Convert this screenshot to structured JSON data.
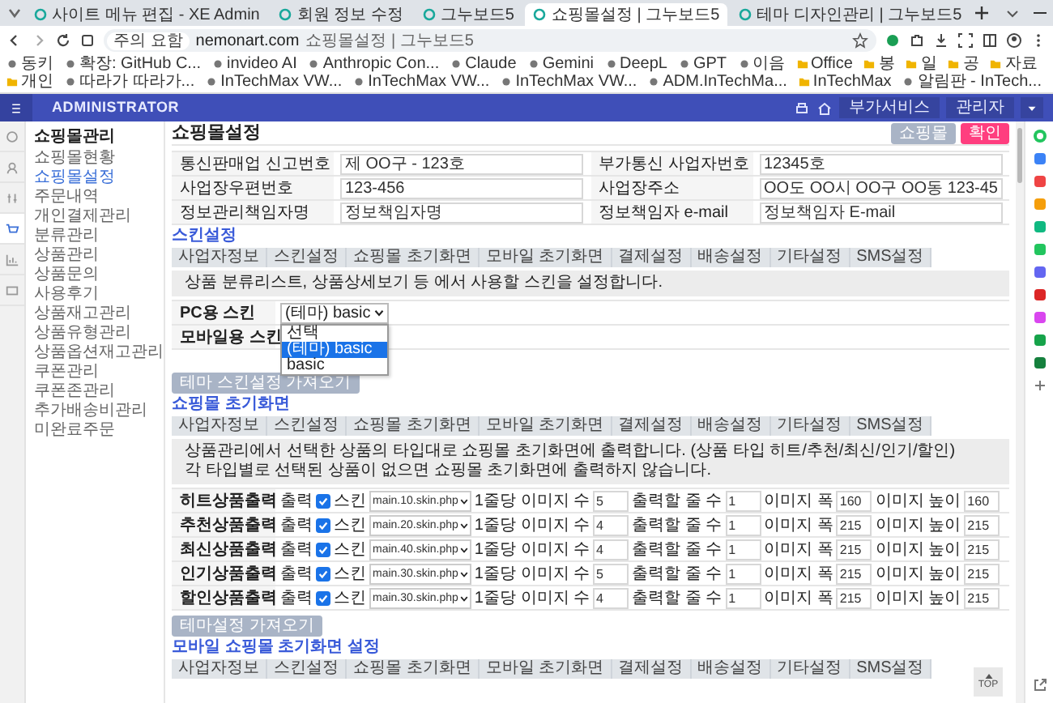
{
  "browser": {
    "tabs": [
      {
        "title": "사이트 메뉴 편집 - XE Admin",
        "selected": false
      },
      {
        "title": "회원 정보 수정",
        "selected": false
      },
      {
        "title": "그누보드5",
        "selected": false
      },
      {
        "title": "쇼핑몰설정 | 그누보드5",
        "selected": true
      },
      {
        "title": "테마 디자인관리 | 그누보드5",
        "selected": false
      }
    ],
    "address": {
      "security": "주의 요함",
      "host": "nemonart.com",
      "page_title": "쇼핑몰설정 | 그누보드5"
    },
    "bookmarks": [
      {
        "label": "동키",
        "kind": "site"
      },
      {
        "label": "확장: GitHub C...",
        "kind": "site"
      },
      {
        "label": "invideo AI",
        "kind": "site"
      },
      {
        "label": "Anthropic Con...",
        "kind": "site"
      },
      {
        "label": "Claude",
        "kind": "site"
      },
      {
        "label": "Gemini",
        "kind": "site"
      },
      {
        "label": "DeepL",
        "kind": "site"
      },
      {
        "label": "GPT",
        "kind": "site"
      },
      {
        "label": "이음",
        "kind": "site"
      },
      {
        "label": "Office",
        "kind": "folder"
      },
      {
        "label": "봉",
        "kind": "folder"
      },
      {
        "label": "일",
        "kind": "folder"
      },
      {
        "label": "공",
        "kind": "folder"
      },
      {
        "label": "자료",
        "kind": "folder"
      },
      {
        "label": "개인",
        "kind": "folder"
      },
      {
        "label": "따라가 따라가...",
        "kind": "site"
      },
      {
        "label": "InTechMax VW...",
        "kind": "site"
      },
      {
        "label": "InTechMax VW...",
        "kind": "site"
      },
      {
        "label": "InTechMax VW...",
        "kind": "site"
      },
      {
        "label": "ADM.InTechMa...",
        "kind": "site"
      },
      {
        "label": "InTechMax",
        "kind": "folder"
      },
      {
        "label": "알림판 - InTech...",
        "kind": "site"
      }
    ]
  },
  "header": {
    "brand": "ADMINISTRATOR",
    "buttons": [
      "부가서비스",
      "관리자"
    ]
  },
  "sidebar": {
    "title": "쇼핑몰관리",
    "items": [
      {
        "label": "쇼핑몰현황",
        "selected": false
      },
      {
        "label": "쇼핑몰설정",
        "selected": true
      },
      {
        "label": "주문내역",
        "selected": false
      },
      {
        "label": "개인결제관리",
        "selected": false
      },
      {
        "label": "분류관리",
        "selected": false
      },
      {
        "label": "상품관리",
        "selected": false
      },
      {
        "label": "상품문의",
        "selected": false
      },
      {
        "label": "사용후기",
        "selected": false
      },
      {
        "label": "상품재고관리",
        "selected": false
      },
      {
        "label": "상품유형관리",
        "selected": false
      },
      {
        "label": "상품옵션재고관리",
        "selected": false
      },
      {
        "label": "쿠폰관리",
        "selected": false
      },
      {
        "label": "쿠폰존관리",
        "selected": false
      },
      {
        "label": "추가배송비관리",
        "selected": false
      },
      {
        "label": "미완료주문",
        "selected": false
      }
    ]
  },
  "page": {
    "title": "쇼핑몰설정",
    "buttons": [
      {
        "label": "쇼핑몰",
        "kind": "secondary"
      },
      {
        "label": "확인",
        "kind": "primary"
      }
    ],
    "info_rows": [
      [
        {
          "label": "통신판매업 신고번호",
          "value": "제 OO구 - 123호"
        },
        {
          "label": "부가통신 사업자번호",
          "value": "12345호"
        }
      ],
      [
        {
          "label": "사업장우편번호",
          "value": "123-456"
        },
        {
          "label": "사업장주소",
          "value": "OO도 OO시 OO구 OO동 123-45"
        }
      ],
      [
        {
          "label": "정보관리책임자명",
          "value": "정보책임자명"
        },
        {
          "label": "정보책임자 e-mail",
          "value": "정보책임자 E-mail"
        }
      ]
    ],
    "skin": {
      "title": "스킨설정",
      "tabs": [
        "사업자정보",
        "스킨설정",
        "쇼핑몰 초기화면",
        "모바일 초기화면",
        "결제설정",
        "배송설정",
        "기타설정",
        "SMS설정"
      ],
      "notes": [
        "상품 분류리스트, 상품상세보기 등 에서 사용할 스킨을 설정합니다."
      ],
      "rows": [
        {
          "label": "PC용 스킨",
          "value": "(테마) basic",
          "open": true,
          "options": [
            {
              "label": "선택",
              "selected": false
            },
            {
              "label": "(테마) basic",
              "selected": true
            },
            {
              "label": "basic",
              "selected": false
            }
          ]
        },
        {
          "label": "모바일용 스킨",
          "open": false
        }
      ],
      "button": "테마 스킨설정 가져오기"
    },
    "main": {
      "title": "쇼핑몰 초기화면",
      "tabs": [
        "사업자정보",
        "스킨설정",
        "쇼핑몰 초기화면",
        "모바일 초기화면",
        "결제설정",
        "배송설정",
        "기타설정",
        "SMS설정"
      ],
      "notes": [
        "상품관리에서 선택한 상품의 타입대로 쇼핑몰 초기화면에 출력합니다. (상품 타입 히트/추천/최신/인기/할인)",
        "각 타입별로 선택된 상품이 없으면 쇼핑몰 초기화면에 출력하지 않습니다."
      ],
      "rows": [
        {
          "label": "히트상품출력",
          "items": [
            {
              "kind": "check",
              "label": "출력",
              "checked": true
            },
            {
              "kind": "select",
              "label": "스킨",
              "value": "main.10.skin.php"
            },
            {
              "kind": "input",
              "label": "1줄당 이미지 수",
              "value": "5"
            },
            {
              "kind": "input",
              "label": "출력할 줄 수",
              "value": "1"
            },
            {
              "kind": "input",
              "label": "이미지 폭",
              "value": "160"
            },
            {
              "kind": "input",
              "label": "이미지 높이",
              "value": "160"
            }
          ]
        },
        {
          "label": "추천상품출력",
          "items": [
            {
              "kind": "check",
              "label": "출력",
              "checked": true
            },
            {
              "kind": "select",
              "label": "스킨",
              "value": "main.20.skin.php"
            },
            {
              "kind": "input",
              "label": "1줄당 이미지 수",
              "value": "4"
            },
            {
              "kind": "input",
              "label": "출력할 줄 수",
              "value": "1"
            },
            {
              "kind": "input",
              "label": "이미지 폭",
              "value": "215"
            },
            {
              "kind": "input",
              "label": "이미지 높이",
              "value": "215"
            }
          ]
        },
        {
          "label": "최신상품출력",
          "items": [
            {
              "kind": "check",
              "label": "출력",
              "checked": true
            },
            {
              "kind": "select",
              "label": "스킨",
              "value": "main.40.skin.php"
            },
            {
              "kind": "input",
              "label": "1줄당 이미지 수",
              "value": "4"
            },
            {
              "kind": "input",
              "label": "출력할 줄 수",
              "value": "1"
            },
            {
              "kind": "input",
              "label": "이미지 폭",
              "value": "215"
            },
            {
              "kind": "input",
              "label": "이미지 높이",
              "value": "215"
            }
          ]
        },
        {
          "label": "인기상품출력",
          "items": [
            {
              "kind": "check",
              "label": "출력",
              "checked": true
            },
            {
              "kind": "select",
              "label": "스킨",
              "value": "main.30.skin.php"
            },
            {
              "kind": "input",
              "label": "1줄당 이미지 수",
              "value": "5"
            },
            {
              "kind": "input",
              "label": "출력할 줄 수",
              "value": "1"
            },
            {
              "kind": "input",
              "label": "이미지 폭",
              "value": "215"
            },
            {
              "kind": "input",
              "label": "이미지 높이",
              "value": "215"
            }
          ]
        },
        {
          "label": "할인상품출력",
          "items": [
            {
              "kind": "check",
              "label": "출력",
              "checked": true
            },
            {
              "kind": "select",
              "label": "스킨",
              "value": "main.30.skin.php"
            },
            {
              "kind": "input",
              "label": "1줄당 이미지 수",
              "value": "4"
            },
            {
              "kind": "input",
              "label": "출력할 줄 수",
              "value": "1"
            },
            {
              "kind": "input",
              "label": "이미지 폭",
              "value": "215"
            },
            {
              "kind": "input",
              "label": "이미지 높이",
              "value": "215"
            }
          ]
        }
      ],
      "button": "테마설정 가져오기"
    },
    "mobile": {
      "title": "모바일 쇼핑몰 초기화면 설정",
      "tabs": [
        "사업자정보",
        "스킨설정",
        "쇼핑몰 초기화면",
        "모바일 초기화면",
        "결제설정",
        "배송설정",
        "기타설정",
        "SMS설정"
      ]
    },
    "top_button": "TOP"
  }
}
